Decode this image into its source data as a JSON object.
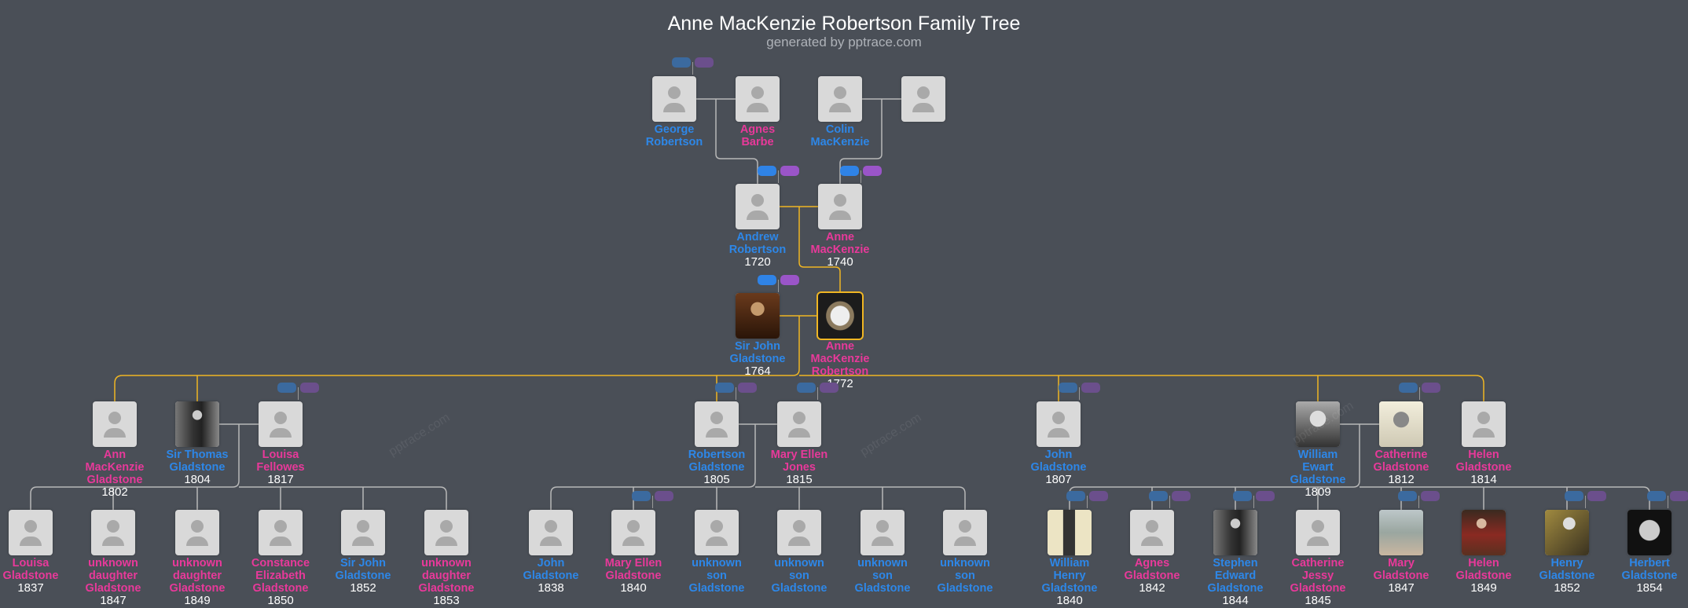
{
  "header": {
    "title": "Anne MacKenzie Robertson Family Tree",
    "subtitle": "generated by pptrace.com"
  },
  "watermark": "pptrace.com",
  "colors": {
    "background": "#4a4f57",
    "male": "#2d87e8",
    "female": "#e8399a",
    "direct_line": "#f0b623",
    "connector": "#b8b8b8",
    "card": "#d9d9d9"
  },
  "people": [
    {
      "lines": [
        "George",
        "Robertson"
      ],
      "year": "",
      "gender": "M"
    },
    {
      "lines": [
        "Agnes",
        "Barbe"
      ],
      "year": "",
      "gender": "F"
    },
    {
      "lines": [
        "Colin",
        "MacKenzie"
      ],
      "year": "",
      "gender": "M"
    },
    {
      "lines": [],
      "year": "",
      "gender": "F"
    },
    {
      "lines": [
        "Andrew",
        "Robertson"
      ],
      "year": "1720",
      "gender": "M"
    },
    {
      "lines": [
        "Anne",
        "MacKenzie"
      ],
      "year": "1740",
      "gender": "F"
    },
    {
      "lines": [
        "Sir John",
        "Gladstone"
      ],
      "year": "1764",
      "gender": "M",
      "photo": "portrait-dark"
    },
    {
      "lines": [
        "Anne",
        "MacKenzie",
        "Robertson"
      ],
      "year": "1772",
      "gender": "F",
      "photo": "cameo",
      "selected": true
    },
    {
      "lines": [
        "Ann",
        "MacKenzie",
        "Gladstone"
      ],
      "year": "1802",
      "gender": "F"
    },
    {
      "lines": [
        "Sir Thomas",
        "Gladstone"
      ],
      "year": "1804",
      "gender": "M",
      "photo": "bw"
    },
    {
      "lines": [
        "Louisa",
        "Fellowes"
      ],
      "year": "1817",
      "gender": "F"
    },
    {
      "lines": [
        "Robertson",
        "Gladstone"
      ],
      "year": "1805",
      "gender": "M"
    },
    {
      "lines": [
        "Mary Ellen",
        "Jones"
      ],
      "year": "1815",
      "gender": "F"
    },
    {
      "lines": [
        "John",
        "Gladstone"
      ],
      "year": "1807",
      "gender": "M"
    },
    {
      "lines": [
        "William",
        "Ewart",
        "Gladstone"
      ],
      "year": "1809",
      "gender": "M",
      "photo": "engraving"
    },
    {
      "lines": [
        "Catherine",
        "Gladstone"
      ],
      "year": "1812",
      "gender": "F",
      "photo": "engraving-light"
    },
    {
      "lines": [
        "Helen",
        "Gladstone"
      ],
      "year": "1814",
      "gender": "F"
    },
    {
      "lines": [
        "Louisa",
        "Gladstone"
      ],
      "year": "1837",
      "gender": "F"
    },
    {
      "lines": [
        "unknown",
        "daughter",
        "Gladstone"
      ],
      "year": "1847",
      "gender": "F"
    },
    {
      "lines": [
        "unknown",
        "daughter",
        "Gladstone"
      ],
      "year": "1849",
      "gender": "F"
    },
    {
      "lines": [
        "Constance",
        "Elizabeth",
        "Gladstone"
      ],
      "year": "1850",
      "gender": "F"
    },
    {
      "lines": [
        "Sir John",
        "Gladstone"
      ],
      "year": "1852",
      "gender": "M"
    },
    {
      "lines": [
        "unknown",
        "daughter",
        "Gladstone"
      ],
      "year": "1853",
      "gender": "F"
    },
    {
      "lines": [
        "John",
        "Gladstone"
      ],
      "year": "1838",
      "gender": "M"
    },
    {
      "lines": [
        "Mary Ellen",
        "Gladstone"
      ],
      "year": "1840",
      "gender": "F"
    },
    {
      "lines": [
        "unknown",
        "son",
        "Gladstone"
      ],
      "year": "",
      "gender": "M"
    },
    {
      "lines": [
        "unknown",
        "son",
        "Gladstone"
      ],
      "year": "",
      "gender": "M"
    },
    {
      "lines": [
        "unknown",
        "son",
        "Gladstone"
      ],
      "year": "",
      "gender": "M"
    },
    {
      "lines": [
        "unknown",
        "son",
        "Gladstone"
      ],
      "year": "",
      "gender": "M"
    },
    {
      "lines": [
        "William",
        "Henry",
        "Gladstone"
      ],
      "year": "1840",
      "gender": "M",
      "photo": "caricature"
    },
    {
      "lines": [
        "Agnes",
        "Gladstone"
      ],
      "year": "1842",
      "gender": "F"
    },
    {
      "lines": [
        "Stephen",
        "Edward",
        "Gladstone"
      ],
      "year": "1844",
      "gender": "M",
      "photo": "bw"
    },
    {
      "lines": [
        "Catherine",
        "Jessy",
        "Gladstone"
      ],
      "year": "1845",
      "gender": "F"
    },
    {
      "lines": [
        "Mary",
        "Gladstone"
      ],
      "year": "1847",
      "gender": "F",
      "photo": "painting-light"
    },
    {
      "lines": [
        "Helen",
        "Gladstone"
      ],
      "year": "1849",
      "gender": "F",
      "photo": "painting-red"
    },
    {
      "lines": [
        "Henry",
        "Gladstone"
      ],
      "year": "1852",
      "gender": "M",
      "photo": "painting-gold"
    },
    {
      "lines": [
        "Herbert",
        "Gladstone"
      ],
      "year": "1854",
      "gender": "M",
      "photo": "bw-dark"
    }
  ]
}
